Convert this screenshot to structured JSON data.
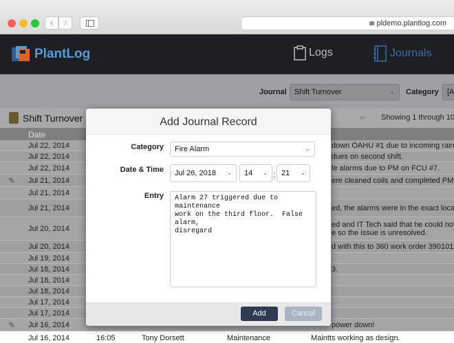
{
  "browser": {
    "url": "pldemo.plantlog.com"
  },
  "app": {
    "name": "PlantLog",
    "nav": [
      {
        "label": "Logs",
        "icon": "clipboard-icon",
        "active": false
      },
      {
        "label": "Journals",
        "icon": "journal-icon",
        "active": true
      }
    ],
    "accent": "#3d6da8"
  },
  "filters": {
    "journal_label": "Journal",
    "journal_value": "Shift Turnover",
    "category_label": "Category",
    "category_value": "[Al"
  },
  "list": {
    "title": "Shift Turnover",
    "showing": "Showing 1 through 10",
    "date_header": "Date",
    "rows": [
      {
        "date": "Jul 22, 2014",
        "note": "down OAHU #1 due to incoming rain.",
        "edit": false
      },
      {
        "date": "Jul 22, 2014",
        "note": "dues on second shift.",
        "edit": false
      },
      {
        "date": "Jul 22, 2014",
        "note": "le alarms due to PM on FCU #7.",
        "edit": false
      },
      {
        "date": "Jul 21, 2014",
        "note": "ere cleaned coils and completed PM on",
        "edit": true
      },
      {
        "date": "Jul 21, 2014",
        "note": "",
        "edit": false
      },
      {
        "date": "Jul 21, 2014",
        "note": "ed, the alarms were in the exact location",
        "edit": false
      },
      {
        "date": "Jul 20, 2014",
        "note": "ed and IT Tech said that he could not c\ne so the issue is unresolved.",
        "edit": false
      },
      {
        "date": "Jul 20, 2014",
        "note": "d with this to 360 work order 3901010",
        "edit": false
      },
      {
        "date": "Jul 19, 2014",
        "note": "",
        "edit": false
      },
      {
        "date": "Jul 18, 2014",
        "note": "3.",
        "edit": false
      },
      {
        "date": "Jul 18, 2014",
        "note": "",
        "edit": false
      },
      {
        "date": "Jul 18, 2014",
        "note": "",
        "edit": false
      },
      {
        "date": "Jul 17, 2014",
        "note": "",
        "edit": false
      },
      {
        "date": "Jul 17, 2014",
        "note": "",
        "edit": false
      },
      {
        "date": "Jul 16, 2014",
        "note": "power down!",
        "edit": true
      }
    ],
    "last_row": {
      "date": "Jul 16, 2014",
      "time": "16:05",
      "user": "Tony Dorsett",
      "category": "Maintenance",
      "note": "Maintts working as design."
    }
  },
  "modal": {
    "title": "Add Journal Record",
    "category_label": "Category",
    "category_value": "Fire Alarm",
    "datetime_label": "Date & Time",
    "date_value": "Jul 26, 2018",
    "hour_value": "14",
    "minute_value": "21",
    "time_separator": ":",
    "entry_label": "Entry",
    "entry_value": "Alarm 27 triggered due to maintenance\nwork on the third floor.  False alarm,\ndisregard",
    "add_label": "Add",
    "cancel_label": "Cancel"
  }
}
